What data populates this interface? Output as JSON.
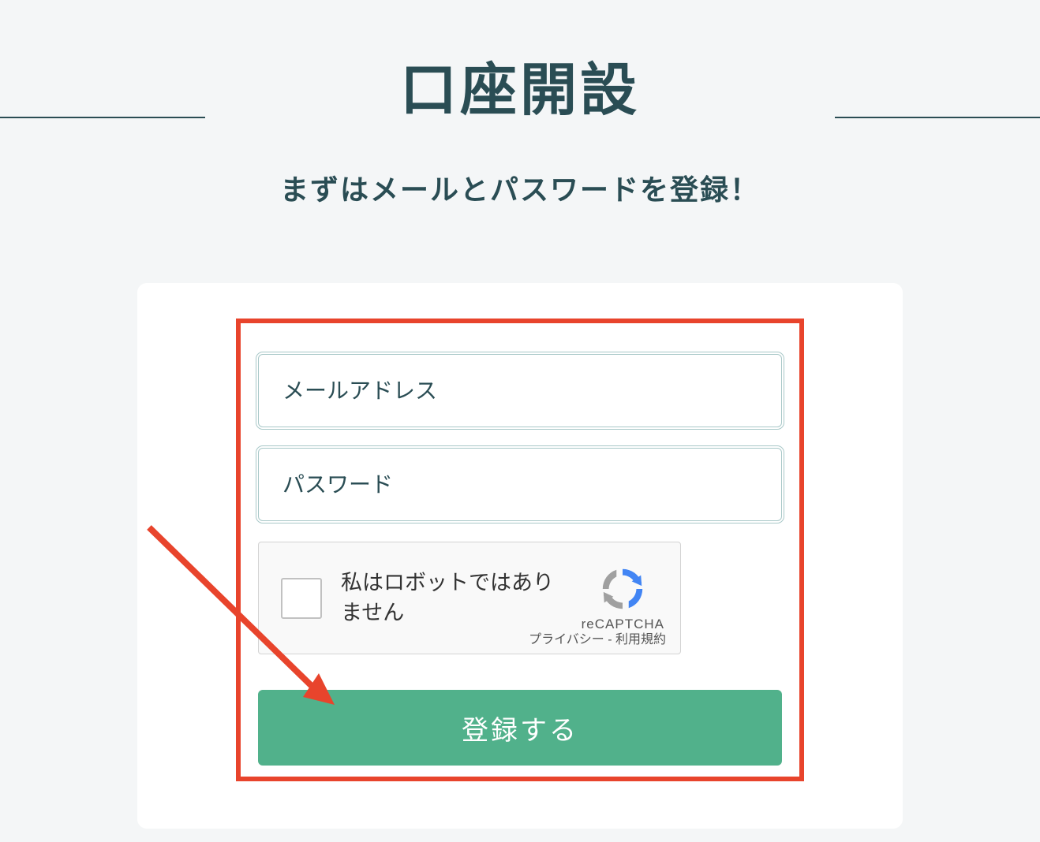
{
  "header": {
    "title": "口座開設",
    "subtitle": "まずはメールとパスワードを登録！"
  },
  "form": {
    "email": {
      "placeholder": "メールアドレス",
      "value": ""
    },
    "password": {
      "placeholder": "パスワード",
      "value": ""
    },
    "recaptcha": {
      "label": "私はロボットではありません",
      "brand": "reCAPTCHA",
      "privacy_label": "プライバシー",
      "separator": " - ",
      "terms_label": "利用規約"
    },
    "submit_label": "登録する"
  }
}
